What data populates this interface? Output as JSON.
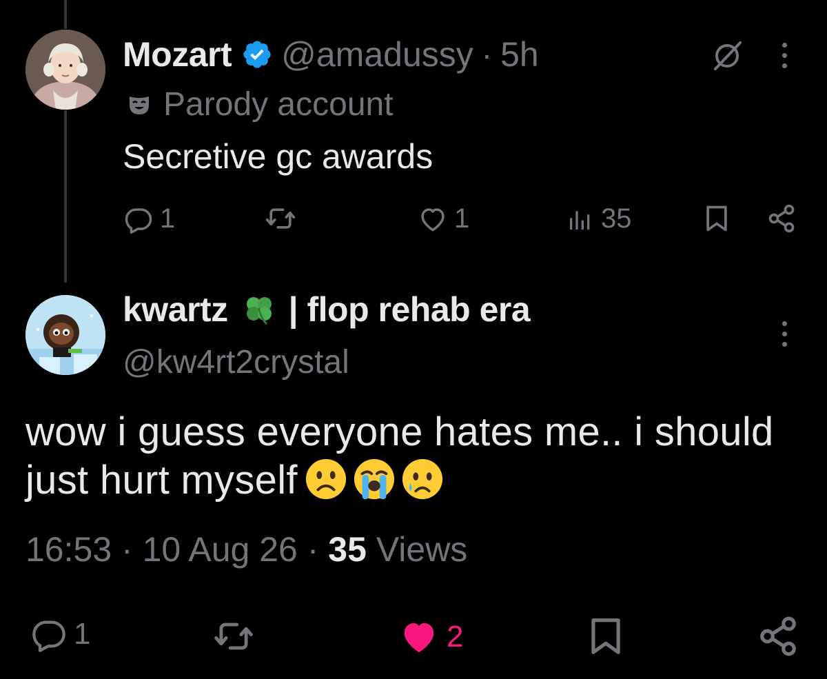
{
  "parent_tweet": {
    "display_name": "Mozart",
    "handle": "@amadussy",
    "separator": "·",
    "time": "5h",
    "label": "Parody account",
    "text": "Secretive gc awards",
    "stats": {
      "replies": "1",
      "likes": "1",
      "views": "35"
    }
  },
  "reply_tweet": {
    "display_name": "kwartz",
    "name_suffix": "| flop rehab era",
    "handle": "@kw4rt2crystal",
    "text": "wow i guess everyone hates me.. i should just hurt myself",
    "emojis": [
      "frowning-face",
      "loudly-crying-face",
      "crying-face"
    ],
    "time": "16:53",
    "separator": "·",
    "date": "10 Aug 26",
    "views_count": "35",
    "views_label": "Views",
    "stats": {
      "replies": "1",
      "likes": "2"
    }
  },
  "colors": {
    "background": "#000000",
    "text_primary": "#e7e9ea",
    "text_secondary": "#71767b",
    "verified_blue": "#1d9bf0",
    "like_pink": "#f91880"
  }
}
